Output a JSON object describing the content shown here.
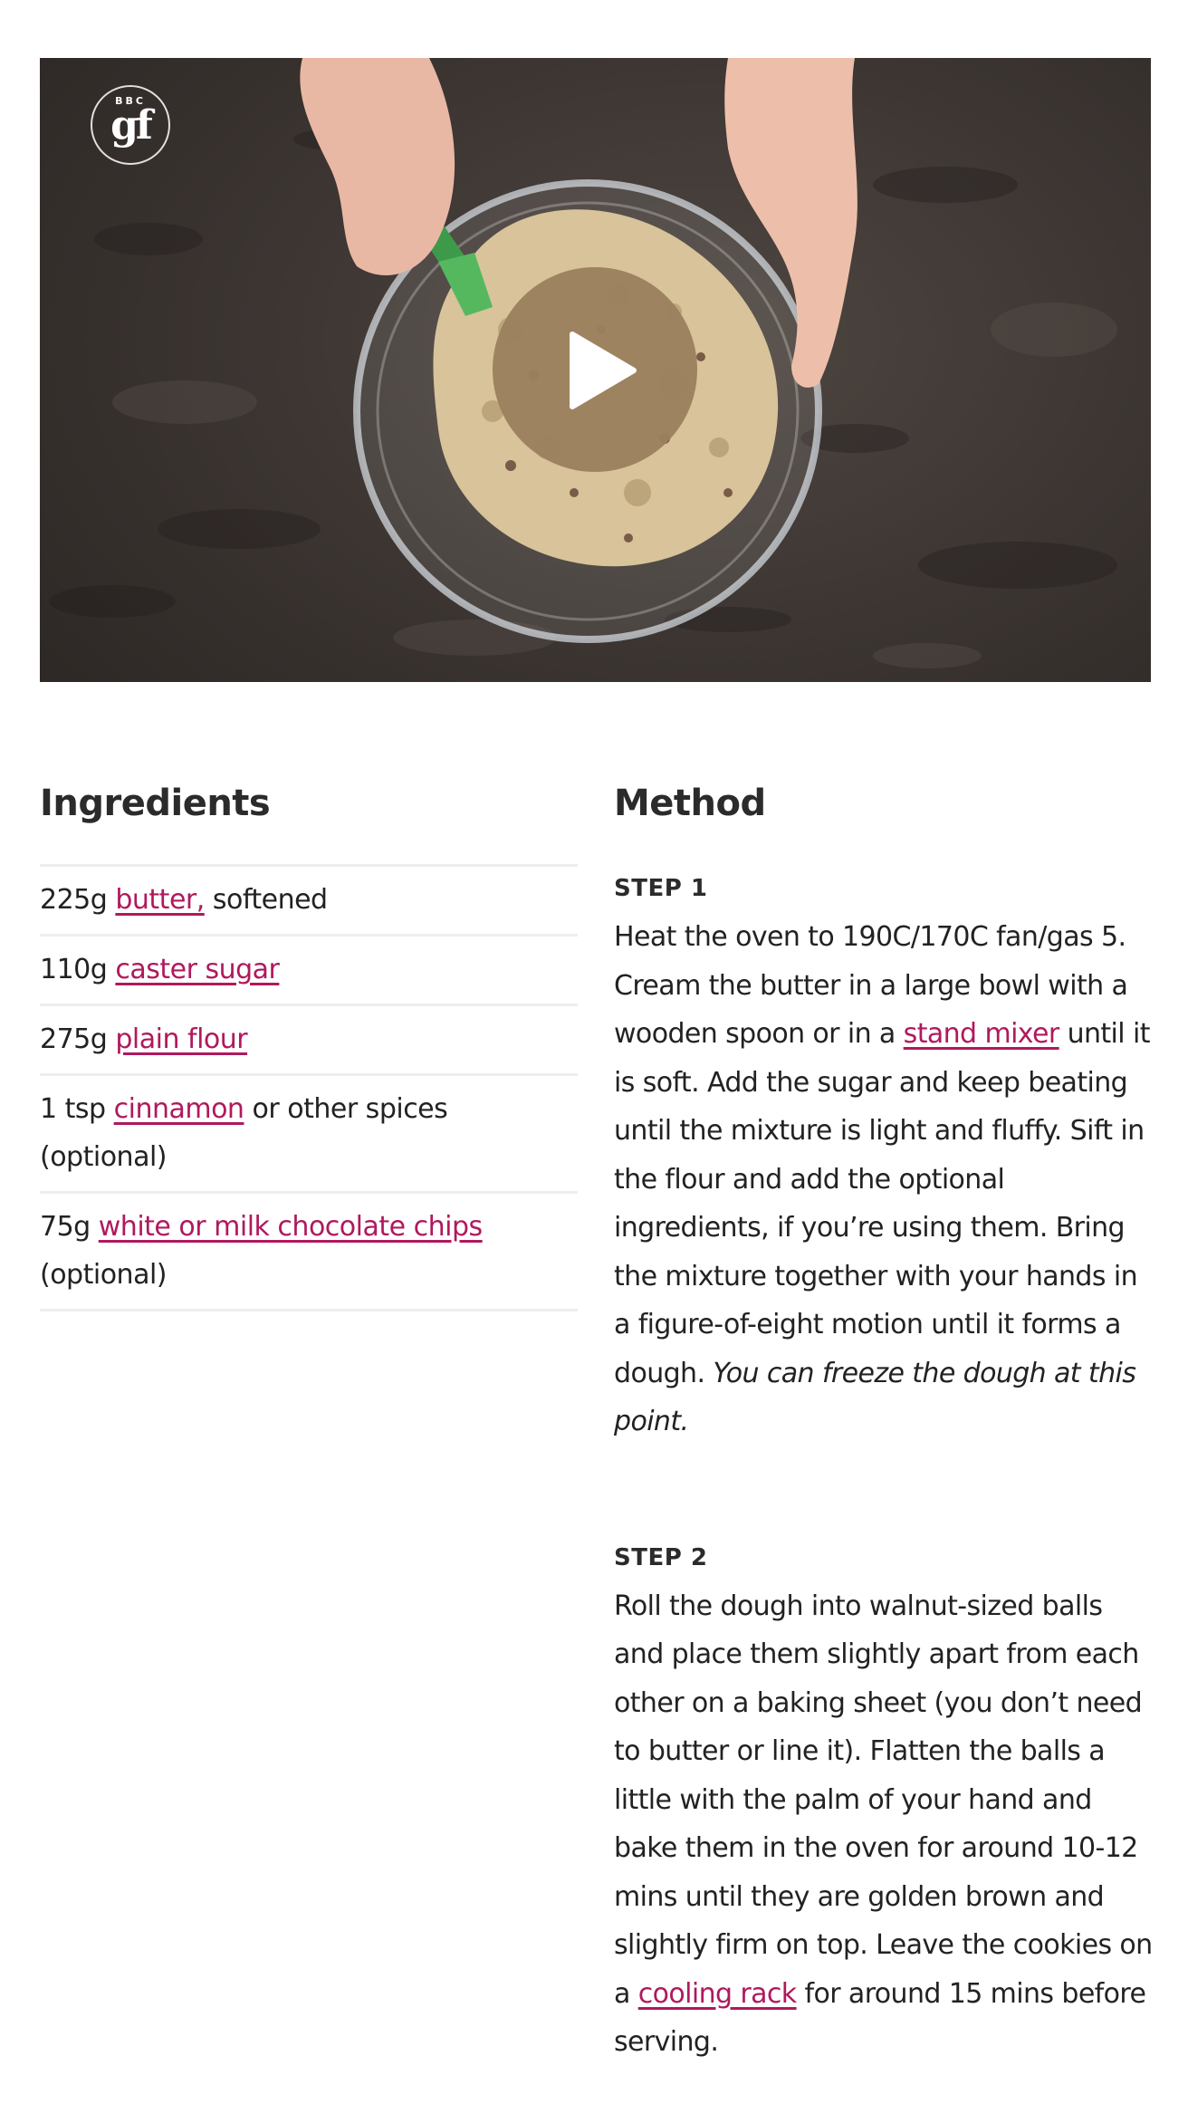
{
  "video": {
    "logo_top": "BBC",
    "logo_main": "gf",
    "play_icon": "play-icon"
  },
  "ingredients": {
    "heading": "Ingredients",
    "items": [
      {
        "qty": "225g",
        "link": "butter,",
        "rest": "softened"
      },
      {
        "qty": "110g",
        "link": "caster sugar",
        "rest": ""
      },
      {
        "qty": "275g",
        "link": "plain flour",
        "rest": ""
      },
      {
        "qty": "1 tsp",
        "link": "cinnamon",
        "rest": "or other spices (optional)"
      },
      {
        "qty": "75g",
        "link": "white or milk chocolate chips",
        "rest": "(optional)"
      }
    ]
  },
  "method": {
    "heading": "Method",
    "steps": [
      {
        "label": "STEP 1",
        "text_before": "Heat the oven to 190C/170C fan/gas 5. Cream the butter in a large bowl with a wooden spoon or in a",
        "link": "stand mixer",
        "text_after": "until it is soft. Add the sugar and keep beating until the mixture is light and fluffy. Sift in the flour and add the optional ingredients, if you’re using them. Bring the mixture together with your hands in a figure-of-eight motion until it forms a dough.",
        "italic": "You can freeze the dough at this point."
      },
      {
        "label": "STEP 2",
        "text_before": "Roll the dough into walnut-sized balls and place them slightly apart from each other on a baking sheet (you don’t need to butter or line it). Flatten the balls a little with the palm of your hand and bake them in the oven for around 10-12 mins until they are golden brown and slightly firm on top. Leave the cookies on a",
        "link": "cooling rack",
        "text_after": "for around 15 mins before serving."
      }
    ]
  },
  "colors": {
    "link": "#b0195d",
    "play_button": "#9b805e",
    "text": "#222222",
    "divider": "#eeeeee"
  }
}
